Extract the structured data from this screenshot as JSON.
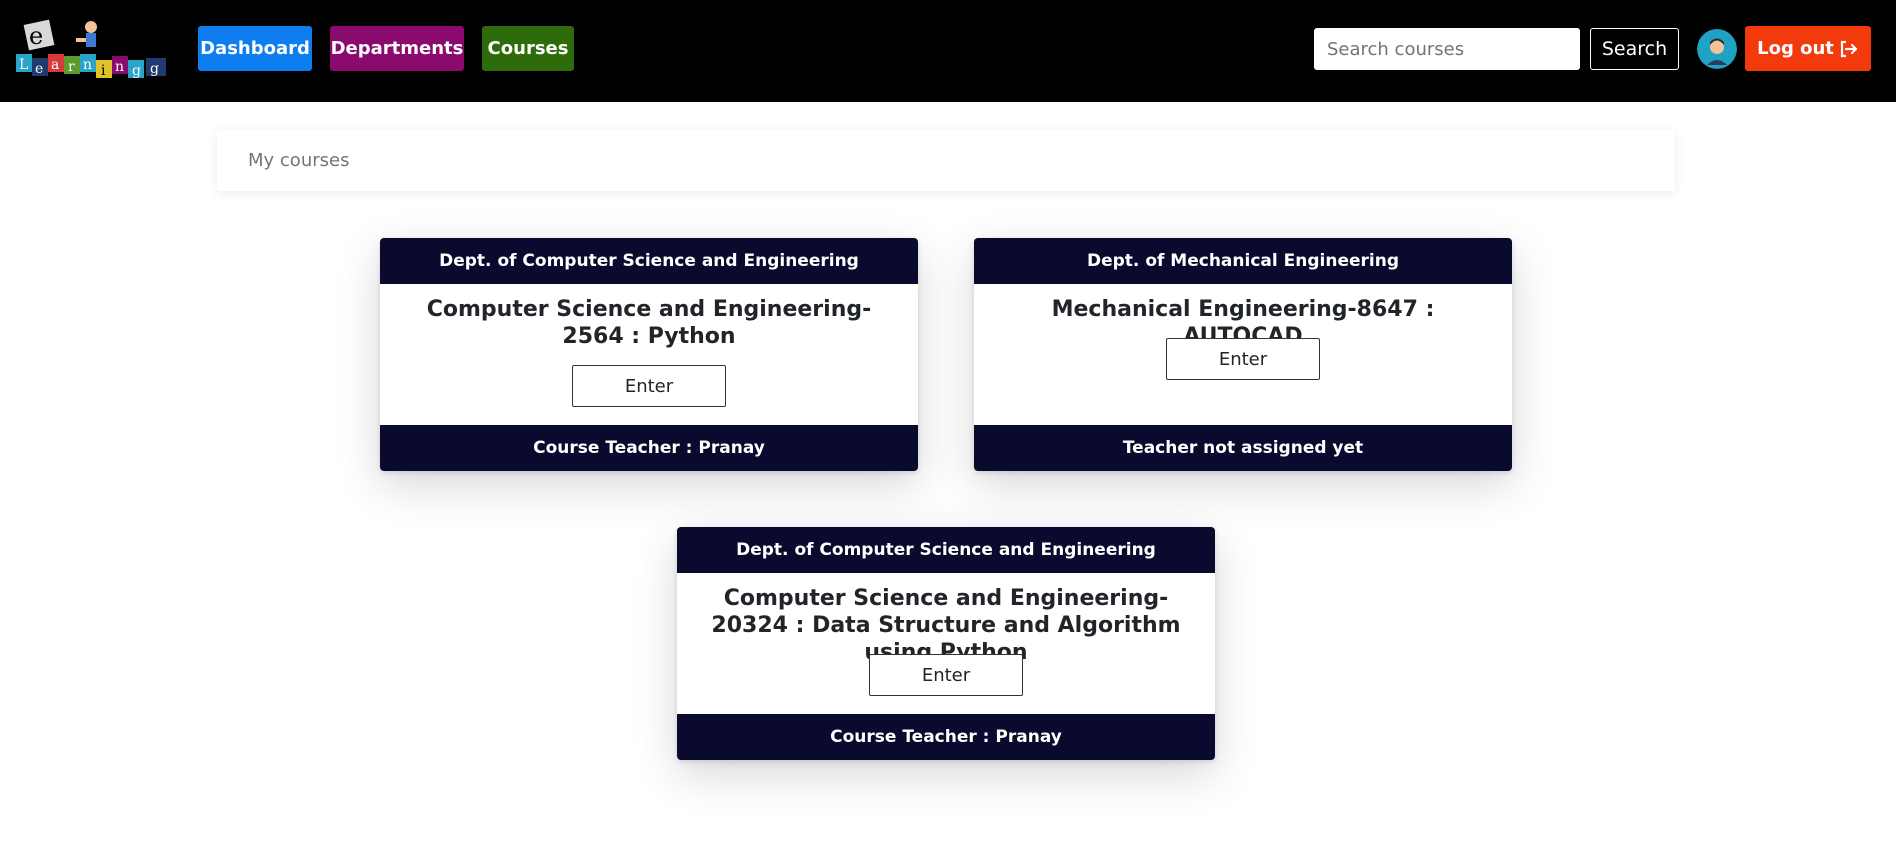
{
  "navbar": {
    "logo_text": "eLearning",
    "links": [
      {
        "label": "Dashboard",
        "color": "#0d7df0"
      },
      {
        "label": "Departments",
        "color": "#8b0a6e"
      },
      {
        "label": "Courses",
        "color": "#2e6b0a"
      }
    ],
    "search": {
      "placeholder": "Search courses",
      "value": "",
      "button_label": "Search"
    },
    "avatar_icon": "user-avatar-icon",
    "logout_label": "Log out",
    "logout_icon": "sign-out-icon",
    "logout_color": "#f23a0c"
  },
  "breadcrumb": {
    "label": "My courses"
  },
  "courses": [
    {
      "department": "Dept. of Computer Science and Engineering",
      "title": "Computer Science and Engineering-2564 : Python",
      "enter_label": "Enter",
      "teacher": "Course Teacher : Pranay"
    },
    {
      "department": "Dept. of Mechanical Engineering",
      "title": "Mechanical Engineering-8647 : AUTOCAD",
      "enter_label": "Enter",
      "teacher": "Teacher not assigned yet"
    },
    {
      "department": "Dept. of Computer Science and Engineering",
      "title": "Computer Science and Engineering-20324 : Data Structure and Algorithm using Python",
      "enter_label": "Enter",
      "teacher": "Course Teacher : Pranay"
    }
  ],
  "colors": {
    "navbar_bg": "#000000",
    "card_band": "#0a0a2e"
  }
}
